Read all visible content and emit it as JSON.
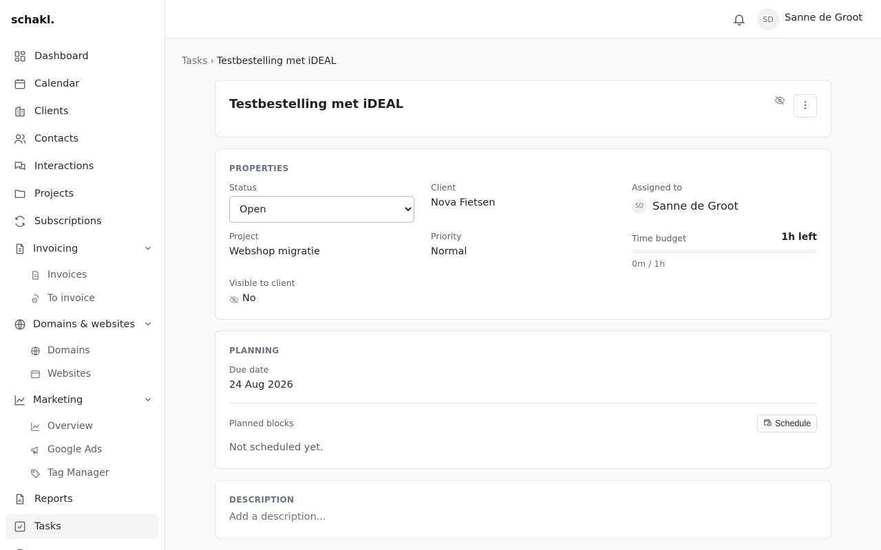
{
  "app": {
    "logo": "schakl."
  },
  "sidebar": {
    "items": [
      {
        "label": "Dashboard",
        "icon": "dashboard-icon"
      },
      {
        "label": "Calendar",
        "icon": "calendar-icon"
      },
      {
        "label": "Clients",
        "icon": "building-icon"
      },
      {
        "label": "Contacts",
        "icon": "users-icon"
      },
      {
        "label": "Interactions",
        "icon": "chat-icon"
      },
      {
        "label": "Projects",
        "icon": "folder-icon"
      },
      {
        "label": "Subscriptions",
        "icon": "refresh-icon"
      }
    ],
    "invoicing": {
      "label": "Invoicing",
      "children": [
        {
          "label": "Invoices"
        },
        {
          "label": "To invoice"
        }
      ]
    },
    "domains": {
      "label": "Domains & websites",
      "children": [
        {
          "label": "Domains"
        },
        {
          "label": "Websites"
        }
      ]
    },
    "marketing": {
      "label": "Marketing",
      "children": [
        {
          "label": "Overview"
        },
        {
          "label": "Google Ads"
        },
        {
          "label": "Tag Manager"
        }
      ]
    },
    "reports": {
      "label": "Reports"
    },
    "tasks": {
      "label": "Tasks"
    }
  },
  "header": {
    "user_initials": "SD",
    "user_name": "Sanne de Groot"
  },
  "breadcrumb": {
    "parent": "Tasks",
    "separator": "›",
    "current": "Testbestelling met iDEAL"
  },
  "task": {
    "title": "Testbestelling met iDEAL"
  },
  "properties": {
    "heading": "PROPERTIES",
    "status_label": "Status",
    "status_value": "Open",
    "client_label": "Client",
    "client_value": "Nova Fietsen",
    "assigned_label": "Assigned to",
    "assignee_initials": "SD",
    "assignee_name": "Sanne de Groot",
    "project_label": "Project",
    "project_value": "Webshop migratie",
    "priority_label": "Priority",
    "priority_value": "Normal",
    "budget_label": "Time budget",
    "budget_left": "1h left",
    "budget_used_fraction": 0,
    "budget_meta": "0m / 1h",
    "visible_label": "Visible to client",
    "visible_value": "No"
  },
  "planning": {
    "heading": "PLANNING",
    "due_label": "Due date",
    "due_value": "24 Aug 2026",
    "blocks_label": "Planned blocks",
    "schedule_button": "Schedule",
    "empty_text": "Not scheduled yet."
  },
  "description": {
    "heading": "DESCRIPTION",
    "placeholder": "Add a description..."
  }
}
